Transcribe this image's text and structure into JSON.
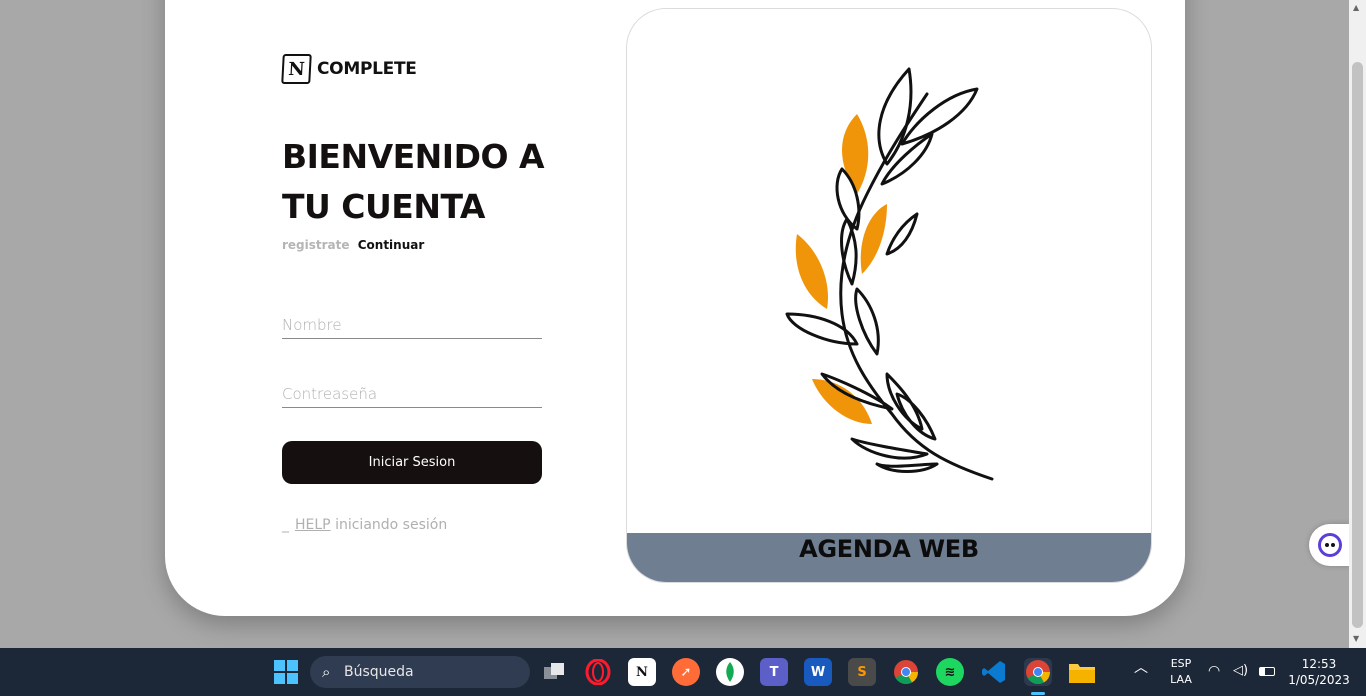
{
  "brand": {
    "logo_letter": "N",
    "name": "COMPLETE"
  },
  "login": {
    "title_line1": "BIENVENIDO A",
    "title_line2": "TU CUENTA",
    "register_link": "registrate",
    "continue_link": "Continuar",
    "name_placeholder": "Nombre",
    "password_placeholder": "Contreaseña",
    "submit_label": "Iniciar Sesion",
    "help_prefix": "_",
    "help_link": "HELP",
    "help_suffix": "iniciando sesión"
  },
  "panel": {
    "caption": "AGENDA WEB",
    "accent": "#f0940a",
    "footer_color": "#6f7e91"
  },
  "taskbar": {
    "search_placeholder": "Búsqueda",
    "apps": [
      "windows-start",
      "task-view",
      "opera",
      "notion",
      "postman",
      "mongodb",
      "teams",
      "word",
      "sublime-text",
      "chrome",
      "spotify",
      "vscode",
      "chrome-active",
      "file-explorer"
    ],
    "lang_line1": "ESP",
    "lang_line2": "LAA",
    "time": "12:53",
    "date": "1/05/2023"
  }
}
